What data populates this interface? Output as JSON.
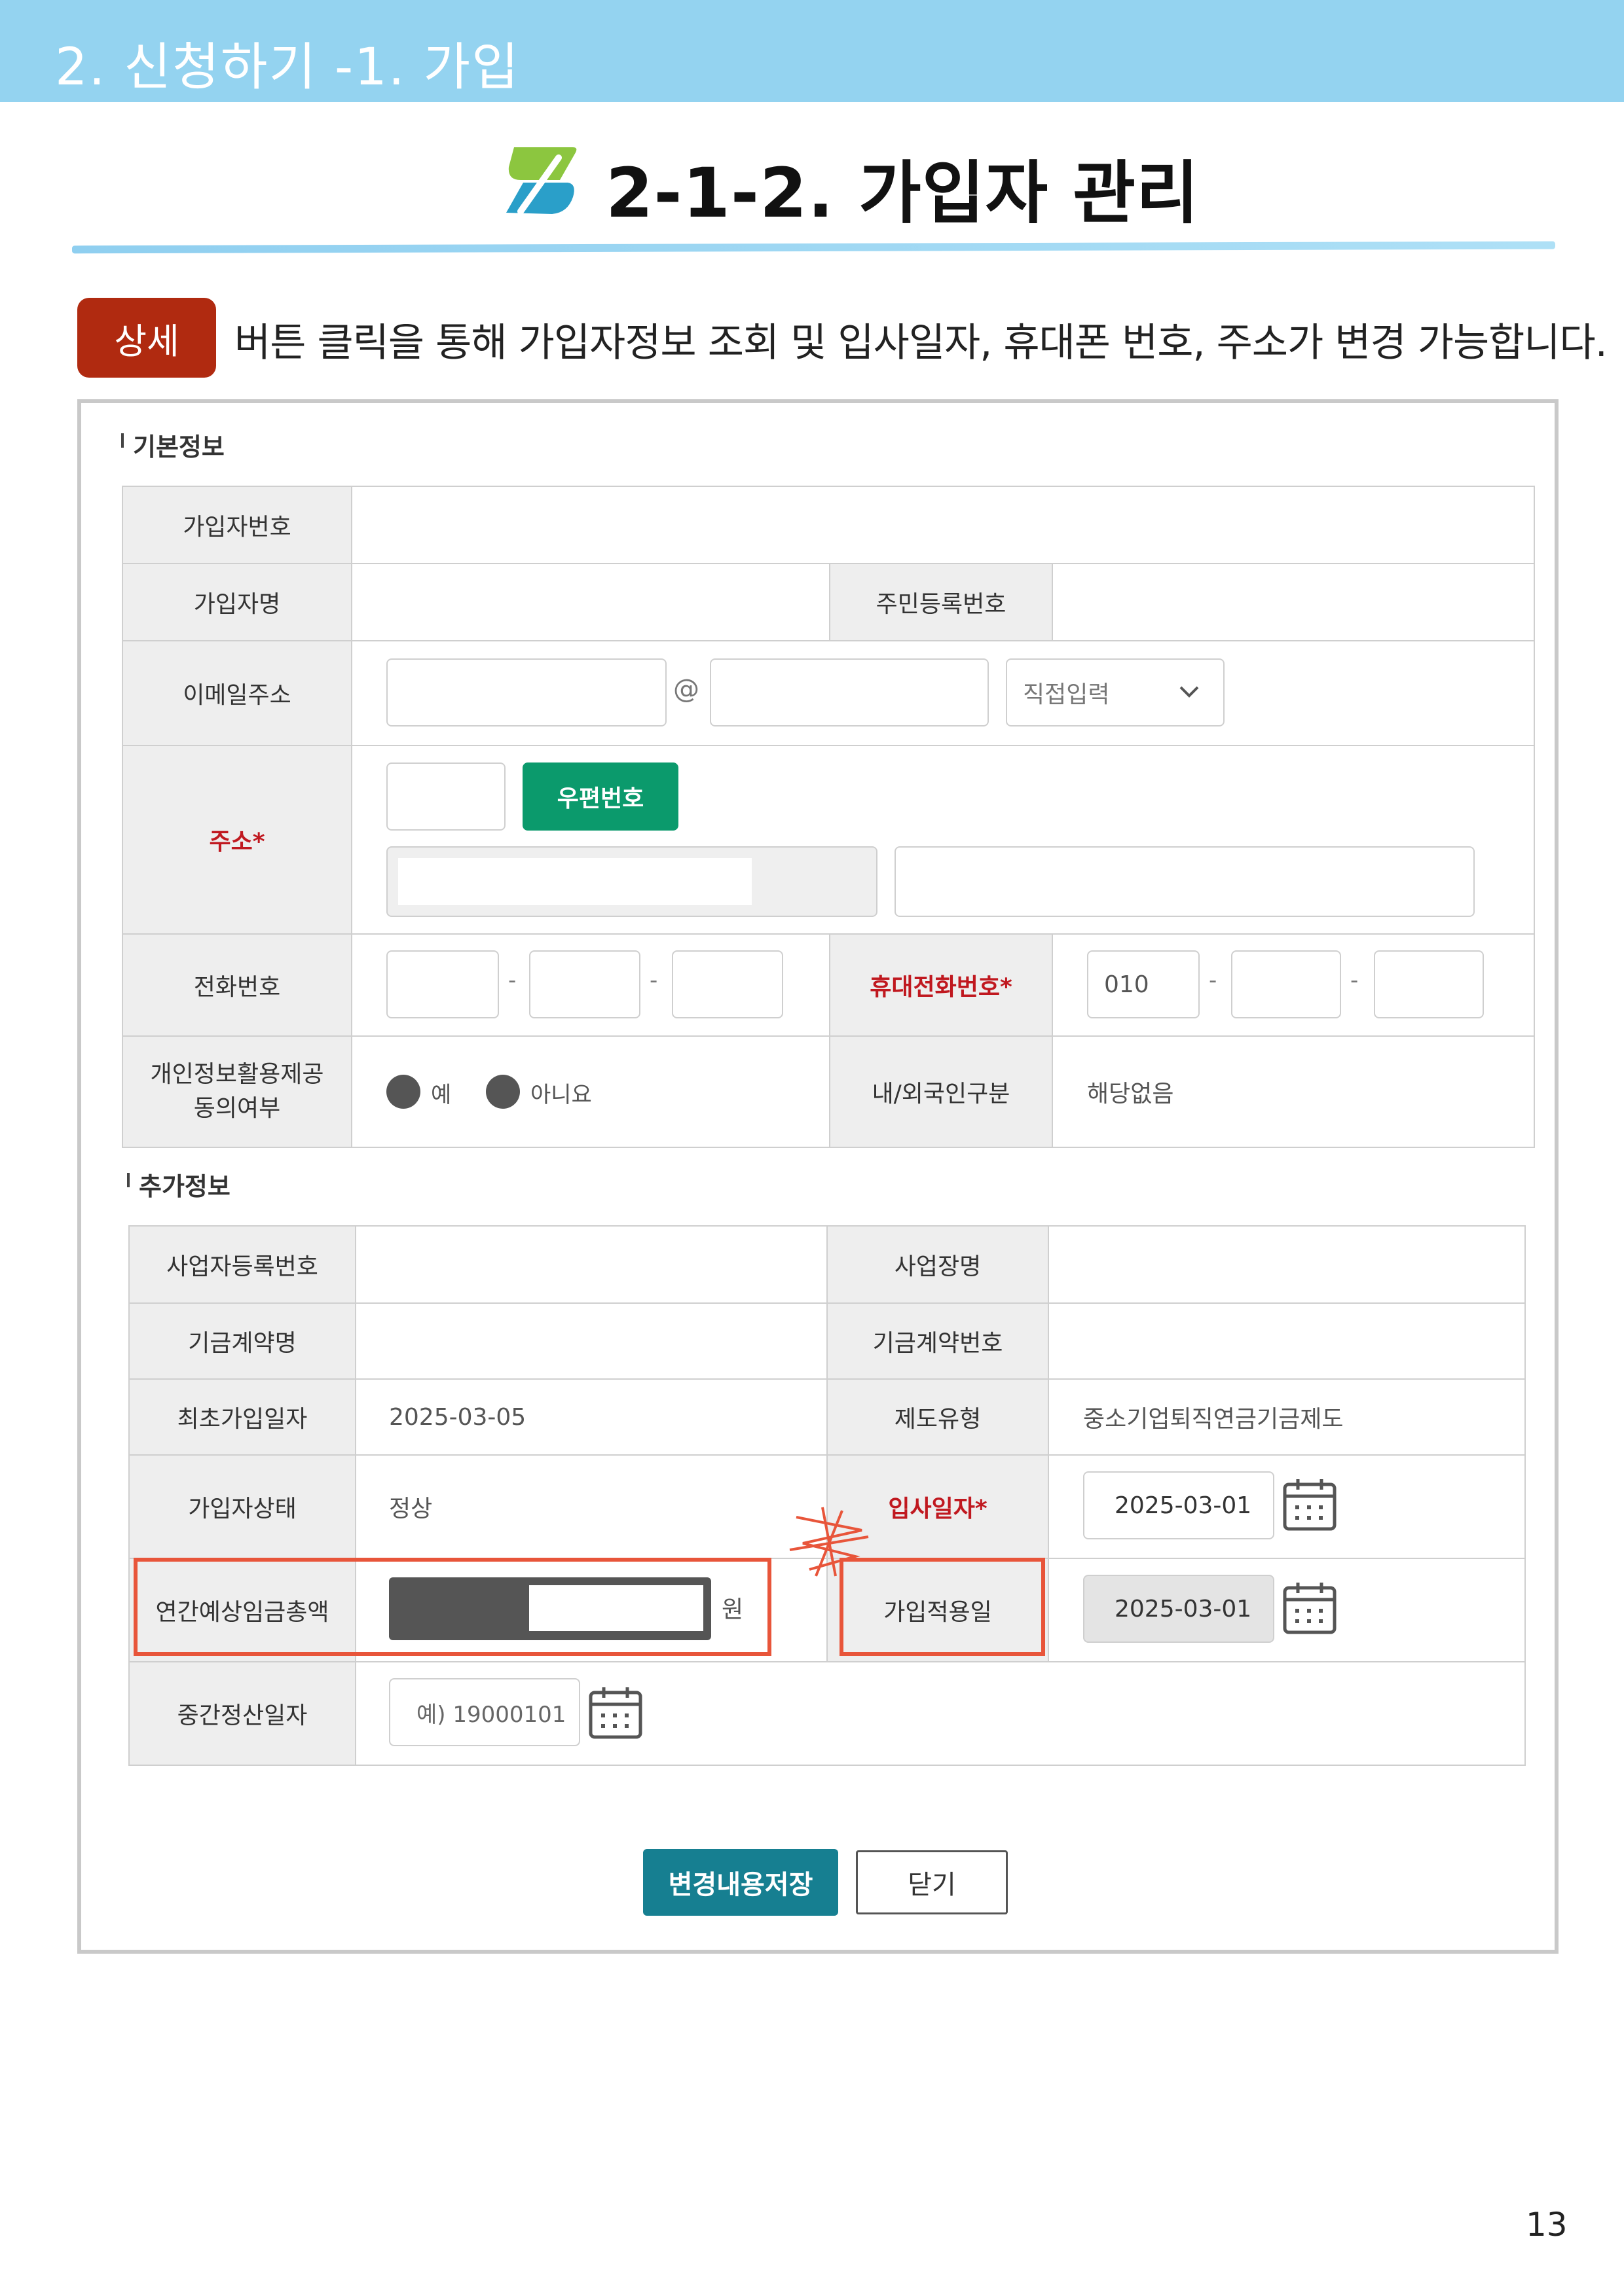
{
  "banner": {
    "title": "2. 신청하기 -1. 가입"
  },
  "heading": {
    "title": "2-1-2. 가입자 관리"
  },
  "intro": {
    "badge": "상세",
    "text": "버튼 클릭을 통해 가입자정보 조회 및 입사일자, 휴대폰 번호, 주소가 변경 가능합니다."
  },
  "basic": {
    "section_title": "기본정보",
    "member_no_label": "가입자번호",
    "member_name_label": "가입자명",
    "resident_no_label": "주민등록번호",
    "email_label": "이메일주소",
    "email_at": "@",
    "email_domain_select": "직접입력",
    "address_label": "주소*",
    "zip_button": "우편번호",
    "phone_label": "전화번호",
    "phone_sep": "-",
    "mobile_label": "휴대전화번호*",
    "mobile_prefix": "010",
    "consent_label_1": "개인정보활용제공",
    "consent_label_2": "동의여부",
    "consent_yes": "예",
    "consent_no": "아니요",
    "nationality_label": "내/외국인구분",
    "nationality_value": "해당없음"
  },
  "extra": {
    "section_title": "추가정보",
    "biz_reg_no_label": "사업자등록번호",
    "workplace_label": "사업장명",
    "fund_contract_name_label": "기금계약명",
    "fund_contract_no_label": "기금계약번호",
    "first_join_date_label": "최초가입일자",
    "first_join_date_value": "2025-03-05",
    "system_type_label": "제도유형",
    "system_type_value": "중소기업퇴직연금기금제도",
    "member_status_label": "가입자상태",
    "member_status_value": "정상",
    "hire_date_label": "입사일자*",
    "hire_date_value": "2025-03-01",
    "annual_wage_label": "연간예상임금총액",
    "annual_wage_unit": "원",
    "apply_date_label": "가입적용일",
    "apply_date_value": "2025-03-01",
    "interim_settle_label": "중간정산일자",
    "interim_settle_placeholder": "예) 19000101"
  },
  "actions": {
    "save": "변경내용저장",
    "close": "닫기"
  },
  "page_number": "13",
  "colors": {
    "banner": "#94d3f0",
    "badge": "#b02a10",
    "highlight": "#e8553a",
    "save": "#167f91",
    "zip": "#0b9a6c",
    "required": "#c0181f"
  }
}
